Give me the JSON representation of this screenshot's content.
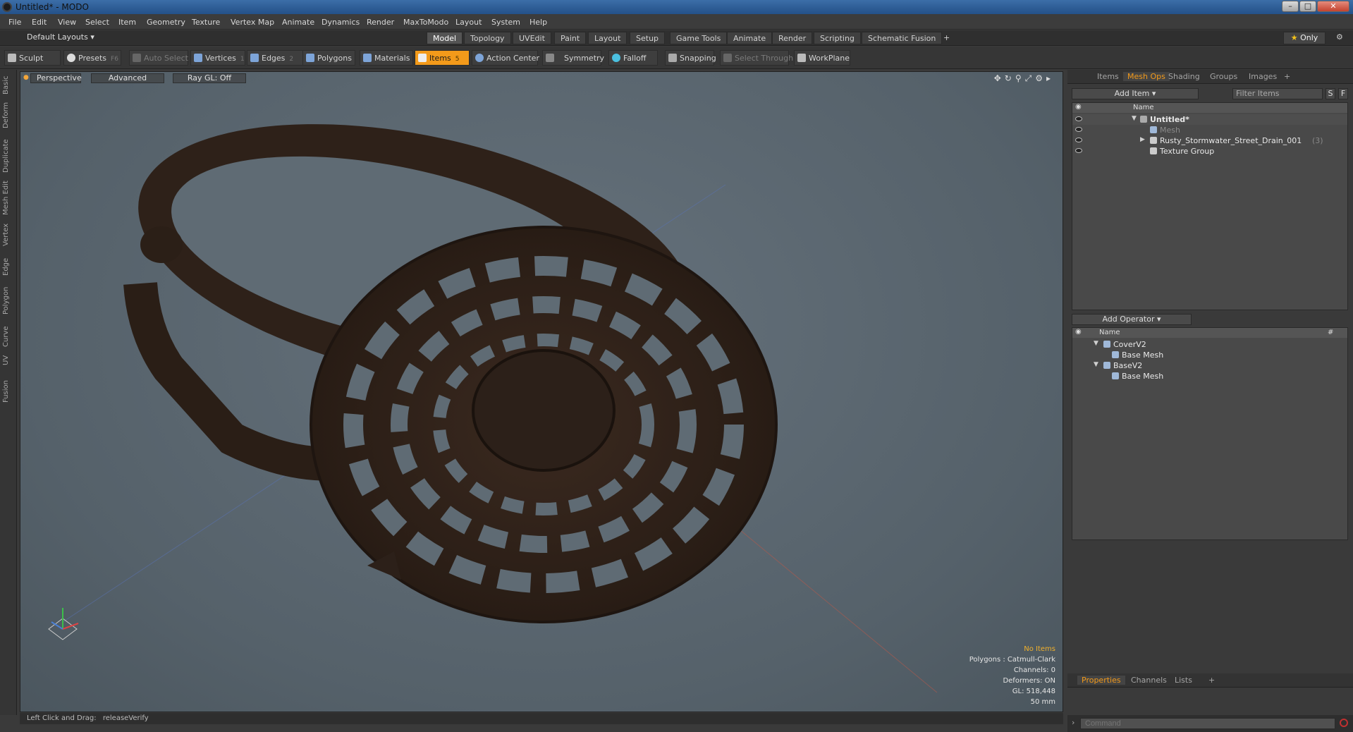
{
  "window": {
    "title": "Untitled* - MODO"
  },
  "menu": [
    "File",
    "Edit",
    "View",
    "Select",
    "Item",
    "Geometry",
    "Texture",
    "Vertex Map",
    "Animate",
    "Dynamics",
    "Render",
    "MaxToModo",
    "Layout",
    "System",
    "Help"
  ],
  "layoutbar": {
    "layout_dropdown": "Default Layouts",
    "tabs": [
      "Model",
      "Topology",
      "UVEdit",
      "Paint",
      "Layout",
      "Setup",
      "Game Tools",
      "Animate",
      "Render",
      "Scripting",
      "Schematic Fusion"
    ],
    "active_tab": "Model",
    "add_symbol": "+",
    "only_label": "Only"
  },
  "toolbar": {
    "sculpt": "Sculpt",
    "presets": "Presets",
    "presets_key": "F6",
    "auto_select": "Auto Select",
    "vertices": "Vertices",
    "vertices_num": "1",
    "edges": "Edges",
    "edges_num": "2",
    "polygons": "Polygons",
    "materials": "Materials",
    "items": "Items",
    "items_num": "5",
    "action_center": "Action Center",
    "symmetry": "Symmetry",
    "falloff": "Falloff",
    "snapping": "Snapping",
    "select_through": "Select Through",
    "workplane": "WorkPlane"
  },
  "left_rail": [
    "Basic",
    "Deform",
    "Duplicate",
    "Mesh Edit",
    "Vertex",
    "Edge",
    "Polygon",
    "Curve",
    "UV",
    "Fusion"
  ],
  "viewport": {
    "view_mode": "Perspective",
    "advanced": "Advanced",
    "raygl": "Ray GL: Off",
    "info": {
      "no_items": "No Items",
      "polygons": "Polygons : Catmull-Clark",
      "channels": "Channels: 0",
      "deformers": "Deformers: ON",
      "gl": "GL: 518,448",
      "scale": "50 mm"
    }
  },
  "status": {
    "hint_label": "Left Click and Drag:",
    "hint_value": "releaseVerify"
  },
  "items_panel": {
    "tabs": [
      "Items",
      "Mesh Ops",
      "Shading",
      "Groups",
      "Images"
    ],
    "active_tab": "Mesh Ops",
    "add_item": "Add Item",
    "filter_placeholder": "Filter Items",
    "s_btn": "S",
    "f_btn": "F",
    "col_name": "Name",
    "rows": [
      {
        "label": "Untitled*"
      },
      {
        "label": "Mesh"
      },
      {
        "label": "Rusty_Stormwater_Street_Drain_001",
        "count": "(3)"
      },
      {
        "label": "Texture Group"
      }
    ]
  },
  "ops_panel": {
    "add_operator": "Add Operator",
    "col_name": "Name",
    "col_hash": "#",
    "rows": [
      {
        "label": "CoverV2"
      },
      {
        "label": "Base Mesh"
      },
      {
        "label": "BaseV2"
      },
      {
        "label": "Base Mesh"
      }
    ]
  },
  "bottom_tabs": [
    "Properties",
    "Channels",
    "Lists"
  ],
  "bottom_active": "Properties",
  "command": {
    "placeholder": "Command"
  },
  "colors": {
    "accent": "#f39a1a",
    "viewport_bg": "#5f6b74",
    "panel_bg": "#3a3a3a"
  }
}
